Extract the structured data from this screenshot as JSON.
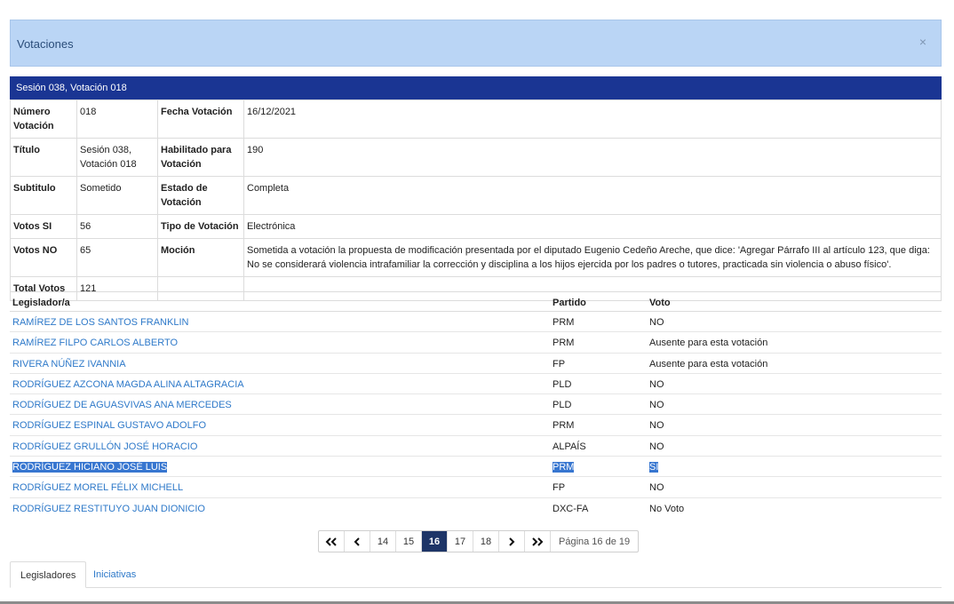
{
  "modal": {
    "title": "Votaciones",
    "close_icon": "×"
  },
  "session": {
    "header": "Sesión 038, Votación 018"
  },
  "details": {
    "numero_label": "Número Votación",
    "numero": "018",
    "fecha_label": "Fecha Votación",
    "fecha": "16/12/2021",
    "titulo_label": "Título",
    "titulo": "Sesión 038, Votación 018",
    "habilitado_label": "Habilitado para Votación",
    "habilitado": "190",
    "subtitulo_label": "Subtitulo",
    "subtitulo": "Sometido",
    "estado_label": "Estado de Votación",
    "estado": "Completa",
    "si_label": "Votos SI",
    "si": "56",
    "tipo_label": "Tipo de Votación",
    "tipo": "Electrónica",
    "no_label": "Votos NO",
    "no": "65",
    "mocion_label": "Moción",
    "mocion": "Sometida a votación la propuesta de modificación presentada por el diputado Eugenio Cedeño Areche, que dice: 'Agregar Párrafo III al artículo 123, que diga: No se considerará violencia intrafamiliar la corrección y disciplina a los hijos ejercida por los padres o tutores, practicada sin violencia o abuso físico'.",
    "total_label": "Total Votos",
    "total": "121"
  },
  "legislators": {
    "headers": {
      "name": "Legislador/a",
      "party": "Partido",
      "vote": "Voto"
    },
    "rows": [
      {
        "name": "RAMÍREZ DE LOS SANTOS FRANKLIN",
        "party": "PRM",
        "vote": "NO"
      },
      {
        "name": "RAMÍREZ FILPO CARLOS ALBERTO",
        "party": "PRM",
        "vote": "Ausente para esta votación"
      },
      {
        "name": "RIVERA NÚÑEZ IVANNIA",
        "party": "FP",
        "vote": "Ausente para esta votación"
      },
      {
        "name": "RODRÍGUEZ AZCONA MAGDA ALINA ALTAGRACIA",
        "party": "PLD",
        "vote": "NO"
      },
      {
        "name": "RODRÍGUEZ DE AGUASVIVAS ANA MERCEDES",
        "party": "PLD",
        "vote": "NO"
      },
      {
        "name": "RODRÍGUEZ ESPINAL GUSTAVO ADOLFO",
        "party": "PRM",
        "vote": "NO"
      },
      {
        "name": "RODRÍGUEZ GRULLÓN JOSÉ HORACIO",
        "party": "ALPAÍS",
        "vote": "NO"
      },
      {
        "name": "RODRÍGUEZ HICIANO JOSÉ LUIS",
        "party": "PRM",
        "vote": "SI"
      },
      {
        "name": "RODRÍGUEZ MOREL FÉLIX MICHELL",
        "party": "FP",
        "vote": "NO"
      },
      {
        "name": "RODRÍGUEZ RESTITUYO JUAN DIONICIO",
        "party": "DXC-FA",
        "vote": "No Voto"
      }
    ]
  },
  "pagination": {
    "first": "«",
    "prev": "‹",
    "next": "›",
    "last": "»",
    "pages": [
      "14",
      "15",
      "16",
      "17",
      "18"
    ],
    "current": "16",
    "info": "Página 16 de 19"
  },
  "tabs": {
    "legisladores": "Legisladores",
    "iniciativas": "Iniciativas"
  }
}
